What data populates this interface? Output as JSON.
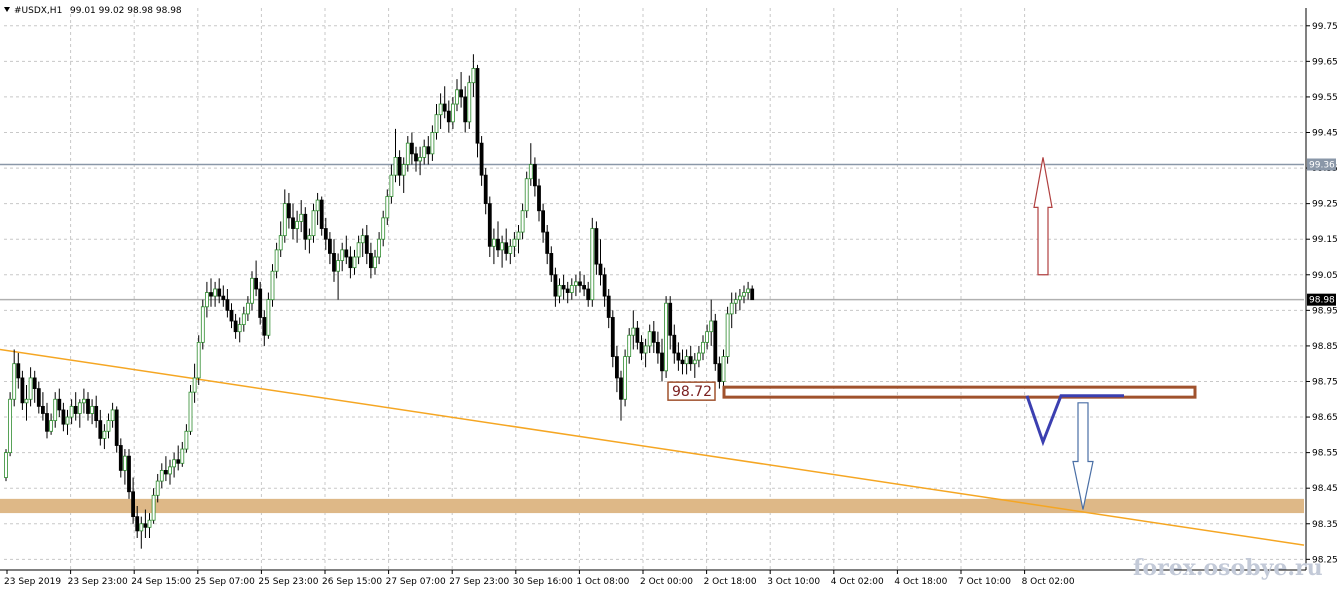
{
  "header": {
    "symbol": "#USDX,H1",
    "ohlc": "99.01 99.02 98.98 98.98"
  },
  "watermark": "forex.osobye.ru",
  "chart_data": {
    "type": "candlestick",
    "grid": true,
    "ylim": [
      98.22,
      99.8
    ],
    "y_ticks": [
      "99.75",
      "99.65",
      "99.55",
      "99.45",
      "99.35",
      "99.25",
      "99.15",
      "99.05",
      "98.95",
      "98.85",
      "98.75",
      "98.65",
      "98.55",
      "98.45",
      "98.35",
      "98.25"
    ],
    "x_ticks": [
      "23 Sep 2019",
      "23 Sep 23:00",
      "24 Sep 15:00",
      "25 Sep 07:00",
      "25 Sep 23:00",
      "26 Sep 15:00",
      "27 Sep 07:00",
      "27 Sep 23:00",
      "30 Sep 16:00",
      "1 Oct 08:00",
      "2 Oct 00:00",
      "2 Oct 18:00",
      "3 Oct 10:00",
      "4 Oct 02:00",
      "4 Oct 18:00",
      "7 Oct 10:00",
      "8 Oct 02:00"
    ],
    "price_labels": [
      {
        "value": 99.36,
        "text": "99.36",
        "color": "#8a97a8"
      },
      {
        "value": 98.98,
        "text": "98.98",
        "color": "#000000"
      }
    ],
    "level_box": {
      "value": 98.72,
      "text": "98.72",
      "color": "#a0522d"
    },
    "horizontal_lines": [
      {
        "value": 99.36,
        "color": "#8a97a8"
      },
      {
        "value": 98.98,
        "color": "#b0b0b0"
      }
    ],
    "support_band": {
      "low": 98.38,
      "high": 98.42,
      "color": "#deb887"
    },
    "trendline": {
      "from": {
        "bar": 0,
        "y": 98.84
      },
      "to": {
        "bar": 268,
        "y": 98.29
      },
      "color": "#f5a623"
    },
    "arrows": [
      {
        "direction": "up",
        "bar": 221,
        "from": 99.05,
        "to": 99.38,
        "color": "#b04040"
      },
      {
        "direction": "down",
        "bar": 231,
        "from": 98.69,
        "to": 98.39,
        "color": "#4a6fa5"
      }
    ],
    "pattern": {
      "color": "#3b3fb0",
      "points": [
        [
          214,
          98.71
        ],
        [
          218,
          98.58
        ],
        [
          223,
          98.71
        ],
        [
          237,
          98.71
        ]
      ]
    },
    "candles": [
      [
        98.48,
        98.56,
        98.47,
        98.55
      ],
      [
        98.55,
        98.72,
        98.54,
        98.7
      ],
      [
        98.7,
        98.84,
        98.68,
        98.8
      ],
      [
        98.8,
        98.83,
        98.73,
        98.76
      ],
      [
        98.76,
        98.78,
        98.67,
        98.69
      ],
      [
        98.69,
        98.74,
        98.64,
        98.7
      ],
      [
        98.7,
        98.79,
        98.68,
        98.76
      ],
      [
        98.76,
        98.78,
        98.69,
        98.73
      ],
      [
        98.73,
        98.75,
        98.66,
        98.68
      ],
      [
        98.68,
        98.72,
        98.64,
        98.66
      ],
      [
        98.66,
        98.69,
        98.59,
        98.61
      ],
      [
        98.61,
        98.66,
        98.6,
        98.64
      ],
      [
        98.64,
        98.72,
        98.62,
        98.7
      ],
      [
        98.7,
        98.73,
        98.65,
        98.67
      ],
      [
        98.67,
        98.69,
        98.61,
        98.63
      ],
      [
        98.63,
        98.67,
        98.6,
        98.65
      ],
      [
        98.65,
        98.7,
        98.63,
        98.68
      ],
      [
        98.68,
        98.72,
        98.64,
        98.66
      ],
      [
        98.66,
        98.7,
        98.62,
        98.69
      ],
      [
        98.69,
        98.73,
        98.66,
        98.7
      ],
      [
        98.7,
        98.72,
        98.64,
        98.66
      ],
      [
        98.66,
        98.7,
        98.63,
        98.68
      ],
      [
        98.68,
        98.71,
        98.62,
        98.64
      ],
      [
        98.64,
        98.67,
        98.57,
        98.59
      ],
      [
        98.59,
        98.63,
        98.56,
        98.61
      ],
      [
        98.61,
        98.66,
        98.59,
        98.64
      ],
      [
        98.64,
        98.69,
        98.62,
        98.67
      ],
      [
        98.67,
        98.68,
        98.55,
        98.57
      ],
      [
        98.57,
        98.59,
        98.48,
        98.5
      ],
      [
        98.5,
        98.56,
        98.46,
        98.54
      ],
      [
        98.54,
        98.56,
        98.42,
        98.44
      ],
      [
        98.44,
        98.48,
        98.35,
        98.37
      ],
      [
        98.37,
        98.4,
        98.31,
        98.33
      ],
      [
        98.33,
        98.37,
        98.28,
        98.35
      ],
      [
        98.35,
        98.39,
        98.31,
        98.34
      ],
      [
        98.34,
        98.38,
        98.31,
        98.36
      ],
      [
        98.36,
        98.45,
        98.35,
        98.43
      ],
      [
        98.43,
        98.49,
        98.41,
        98.47
      ],
      [
        98.47,
        98.52,
        98.45,
        98.5
      ],
      [
        98.5,
        98.54,
        98.47,
        98.49
      ],
      [
        98.49,
        98.53,
        98.46,
        98.51
      ],
      [
        98.51,
        98.55,
        98.48,
        98.53
      ],
      [
        98.53,
        98.57,
        98.5,
        98.52
      ],
      [
        98.52,
        98.58,
        98.51,
        98.56
      ],
      [
        98.56,
        98.63,
        98.55,
        98.61
      ],
      [
        98.61,
        98.74,
        98.6,
        98.72
      ],
      [
        98.72,
        98.8,
        98.69,
        98.76
      ],
      [
        98.76,
        98.88,
        98.74,
        98.86
      ],
      [
        98.86,
        98.98,
        98.84,
        98.96
      ],
      [
        98.96,
        99.03,
        98.93,
        99.0
      ],
      [
        99.0,
        99.04,
        98.96,
        98.99
      ],
      [
        98.99,
        99.03,
        98.96,
        99.01
      ],
      [
        99.01,
        99.04,
        98.97,
        98.99
      ],
      [
        98.99,
        99.02,
        98.96,
        98.98
      ],
      [
        98.98,
        99.01,
        98.93,
        98.95
      ],
      [
        98.95,
        98.97,
        98.9,
        98.92
      ],
      [
        98.92,
        98.94,
        98.87,
        98.89
      ],
      [
        98.89,
        98.93,
        98.86,
        98.91
      ],
      [
        98.91,
        98.96,
        98.89,
        98.94
      ],
      [
        98.94,
        98.99,
        98.92,
        98.97
      ],
      [
        98.97,
        99.06,
        98.95,
        99.04
      ],
      [
        99.04,
        99.09,
        98.99,
        99.01
      ],
      [
        99.01,
        99.03,
        98.91,
        98.93
      ],
      [
        98.93,
        98.95,
        98.85,
        98.88
      ],
      [
        98.88,
        99.0,
        98.87,
        98.98
      ],
      [
        98.98,
        99.08,
        98.96,
        99.06
      ],
      [
        99.06,
        99.14,
        99.04,
        99.12
      ],
      [
        99.12,
        99.2,
        99.1,
        99.16
      ],
      [
        99.16,
        99.29,
        99.14,
        99.25
      ],
      [
        99.25,
        99.28,
        99.18,
        99.21
      ],
      [
        99.21,
        99.25,
        99.15,
        99.18
      ],
      [
        99.18,
        99.23,
        99.14,
        99.2
      ],
      [
        99.2,
        99.26,
        99.17,
        99.22
      ],
      [
        99.22,
        99.24,
        99.12,
        99.15
      ],
      [
        99.15,
        99.18,
        99.11,
        99.16
      ],
      [
        99.16,
        99.25,
        99.14,
        99.23
      ],
      [
        99.23,
        99.28,
        99.19,
        99.26
      ],
      [
        99.26,
        99.27,
        99.16,
        99.18
      ],
      [
        99.18,
        99.21,
        99.12,
        99.15
      ],
      [
        99.15,
        99.17,
        99.08,
        99.11
      ],
      [
        99.11,
        99.15,
        99.03,
        99.06
      ],
      [
        99.06,
        99.11,
        98.98,
        99.09
      ],
      [
        99.09,
        99.14,
        99.06,
        99.12
      ],
      [
        99.12,
        99.16,
        99.08,
        99.1
      ],
      [
        99.1,
        99.13,
        99.04,
        99.07
      ],
      [
        99.07,
        99.12,
        99.05,
        99.1
      ],
      [
        99.1,
        99.16,
        99.08,
        99.14
      ],
      [
        99.14,
        99.18,
        99.1,
        99.16
      ],
      [
        99.16,
        99.19,
        99.08,
        99.11
      ],
      [
        99.11,
        99.14,
        99.04,
        99.07
      ],
      [
        99.07,
        99.12,
        99.05,
        99.1
      ],
      [
        99.1,
        99.17,
        99.08,
        99.15
      ],
      [
        99.15,
        99.23,
        99.13,
        99.21
      ],
      [
        99.21,
        99.29,
        99.19,
        99.27
      ],
      [
        99.27,
        99.36,
        99.25,
        99.33
      ],
      [
        99.33,
        99.46,
        99.31,
        99.38
      ],
      [
        99.38,
        99.4,
        99.3,
        99.33
      ],
      [
        99.33,
        99.38,
        99.28,
        99.36
      ],
      [
        99.36,
        99.44,
        99.34,
        99.42
      ],
      [
        99.42,
        99.45,
        99.36,
        99.39
      ],
      [
        99.39,
        99.41,
        99.34,
        99.37
      ],
      [
        99.37,
        99.41,
        99.33,
        99.38
      ],
      [
        99.38,
        99.43,
        99.36,
        99.41
      ],
      [
        99.41,
        99.44,
        99.36,
        99.39
      ],
      [
        99.39,
        99.47,
        99.37,
        99.45
      ],
      [
        99.45,
        99.53,
        99.43,
        99.5
      ],
      [
        99.5,
        99.56,
        99.46,
        99.53
      ],
      [
        99.53,
        99.58,
        99.49,
        99.51
      ],
      [
        99.51,
        99.54,
        99.45,
        99.48
      ],
      [
        99.48,
        99.55,
        99.46,
        99.53
      ],
      [
        99.53,
        99.6,
        99.51,
        99.57
      ],
      [
        99.57,
        99.62,
        99.52,
        99.55
      ],
      [
        99.55,
        99.58,
        99.45,
        99.48
      ],
      [
        99.48,
        99.61,
        99.46,
        99.59
      ],
      [
        99.59,
        99.67,
        99.55,
        99.63
      ],
      [
        99.63,
        99.64,
        99.38,
        99.42
      ],
      [
        99.42,
        99.44,
        99.3,
        99.33
      ],
      [
        99.33,
        99.35,
        99.22,
        99.25
      ],
      [
        99.25,
        99.27,
        99.1,
        99.13
      ],
      [
        99.13,
        99.18,
        99.08,
        99.15
      ],
      [
        99.15,
        99.2,
        99.1,
        99.12
      ],
      [
        99.12,
        99.16,
        99.07,
        99.14
      ],
      [
        99.14,
        99.18,
        99.09,
        99.11
      ],
      [
        99.11,
        99.15,
        99.08,
        99.13
      ],
      [
        99.13,
        99.17,
        99.1,
        99.15
      ],
      [
        99.15,
        99.19,
        99.11,
        99.17
      ],
      [
        99.17,
        99.25,
        99.15,
        99.23
      ],
      [
        99.23,
        99.34,
        99.21,
        99.32
      ],
      [
        99.32,
        99.42,
        99.3,
        99.36
      ],
      [
        99.36,
        99.38,
        99.27,
        99.3
      ],
      [
        99.3,
        99.32,
        99.2,
        99.23
      ],
      [
        99.23,
        99.25,
        99.14,
        99.17
      ],
      [
        99.17,
        99.19,
        99.08,
        99.11
      ],
      [
        99.11,
        99.13,
        99.03,
        99.05
      ],
      [
        99.05,
        99.07,
        98.96,
        98.99
      ],
      [
        98.99,
        99.04,
        98.97,
        99.02
      ],
      [
        99.02,
        99.05,
        98.98,
        99.01
      ],
      [
        99.01,
        99.03,
        98.97,
        99.0
      ],
      [
        99.0,
        99.04,
        98.98,
        99.02
      ],
      [
        99.02,
        99.05,
        98.99,
        99.03
      ],
      [
        99.03,
        99.06,
        99.0,
        99.02
      ],
      [
        99.02,
        99.05,
        98.99,
        99.01
      ],
      [
        99.01,
        99.03,
        98.96,
        98.98
      ],
      [
        98.98,
        99.21,
        98.96,
        99.18
      ],
      [
        99.18,
        99.2,
        99.05,
        99.08
      ],
      [
        99.08,
        99.15,
        99.02,
        99.05
      ],
      [
        99.05,
        99.07,
        98.96,
        98.99
      ],
      [
        98.99,
        99.01,
        98.9,
        98.93
      ],
      [
        98.93,
        98.95,
        98.79,
        98.82
      ],
      [
        98.82,
        98.85,
        98.72,
        98.76
      ],
      [
        98.76,
        98.78,
        98.64,
        98.7
      ],
      [
        98.7,
        98.84,
        98.68,
        98.82
      ],
      [
        98.82,
        98.9,
        98.8,
        98.88
      ],
      [
        98.88,
        98.95,
        98.84,
        98.9
      ],
      [
        98.9,
        98.92,
        98.84,
        98.86
      ],
      [
        98.86,
        98.88,
        98.81,
        98.83
      ],
      [
        98.83,
        98.87,
        98.79,
        98.85
      ],
      [
        98.85,
        98.91,
        98.83,
        98.89
      ],
      [
        98.89,
        98.92,
        98.83,
        98.86
      ],
      [
        98.86,
        98.89,
        98.8,
        98.83
      ],
      [
        98.83,
        98.87,
        98.75,
        98.78
      ],
      [
        98.78,
        98.99,
        98.76,
        98.97
      ],
      [
        98.97,
        98.99,
        98.84,
        98.88
      ],
      [
        98.88,
        98.91,
        98.8,
        98.83
      ],
      [
        98.83,
        98.86,
        98.78,
        98.81
      ],
      [
        98.81,
        98.84,
        98.77,
        98.8
      ],
      [
        98.8,
        98.84,
        98.77,
        98.82
      ],
      [
        98.82,
        98.85,
        98.78,
        98.8
      ],
      [
        98.8,
        98.83,
        98.76,
        98.81
      ],
      [
        98.81,
        98.85,
        98.79,
        98.83
      ],
      [
        98.83,
        98.88,
        98.81,
        98.86
      ],
      [
        98.86,
        98.91,
        98.84,
        98.89
      ],
      [
        98.89,
        98.98,
        98.85,
        98.92
      ],
      [
        98.92,
        98.94,
        98.78,
        98.8
      ],
      [
        98.8,
        98.82,
        98.73,
        98.75
      ],
      [
        98.75,
        98.84,
        98.73,
        98.82
      ],
      [
        98.82,
        98.96,
        98.8,
        98.94
      ],
      [
        98.94,
        99.0,
        98.9,
        98.97
      ],
      [
        98.97,
        99.0,
        98.94,
        98.98
      ],
      [
        98.98,
        99.01,
        98.95,
        98.99
      ],
      [
        98.99,
        99.02,
        98.97,
        99.0
      ],
      [
        99.0,
        99.03,
        98.98,
        99.01
      ],
      [
        99.01,
        99.02,
        98.98,
        98.98
      ]
    ]
  }
}
